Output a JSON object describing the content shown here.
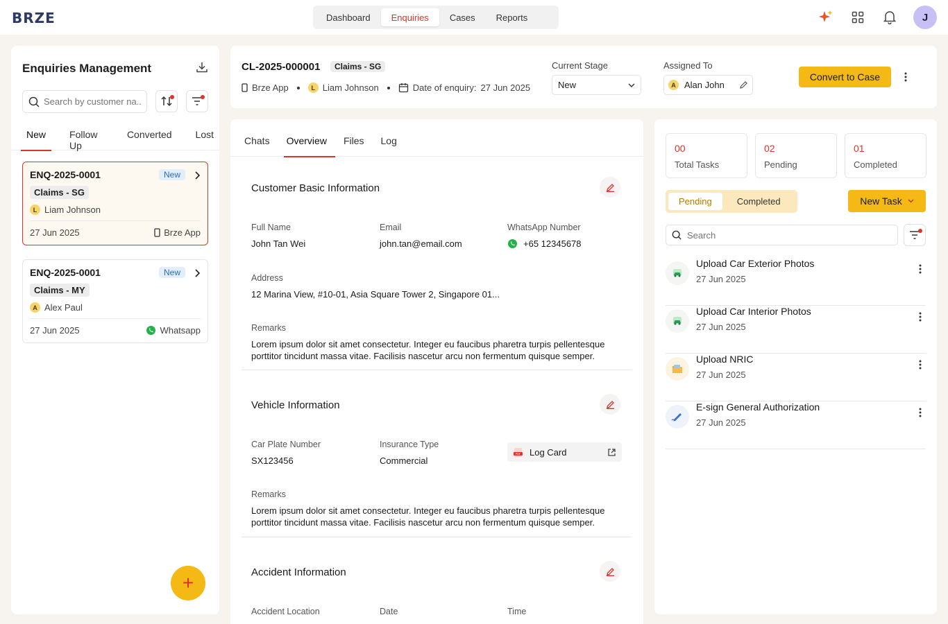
{
  "brand": {
    "logo": "BRZE"
  },
  "nav": {
    "items": [
      "Dashboard",
      "Enquiries",
      "Cases",
      "Reports"
    ],
    "active": "Enquiries"
  },
  "user": {
    "initial": "J"
  },
  "left": {
    "title": "Enquiries Management",
    "search_placeholder": "Search by customer na...",
    "tabs": [
      "New",
      "Follow Up",
      "Converted",
      "Lost"
    ],
    "cards": [
      {
        "id": "ENQ-2025-0001",
        "status": "New",
        "tag": "Claims - SG",
        "initial": "L",
        "person": "Liam Johnson",
        "date": "27 Jun 2025",
        "source": "Brze App"
      },
      {
        "id": "ENQ-2025-0001",
        "status": "New",
        "tag": "Claims - MY",
        "initial": "A",
        "person": "Alex Paul",
        "date": "27 Jun 2025",
        "source": "Whatsapp"
      }
    ],
    "fab": "+"
  },
  "header": {
    "case_id": "CL-2025-000001",
    "tag": "Claims - SG",
    "source": "Brze App",
    "owner_initial": "L",
    "owner": "Liam Johnson",
    "date_label": "Date of enquiry:",
    "date": "27 Jun 2025",
    "stage_label": "Current Stage",
    "stage_value": "New",
    "assigned_label": "Assigned To",
    "assigned_initial": "A",
    "assigned_value": "Alan John",
    "convert_label": "Convert to Case"
  },
  "mid": {
    "tabs": [
      "Chats",
      "Overview",
      "Files",
      "Log"
    ],
    "active_tab": "Overview",
    "customer": {
      "title": "Customer Basic Information",
      "full_name_label": "Full Name",
      "full_name": "John Tan Wei",
      "email_label": "Email",
      "email": "john.tan@email.com",
      "whatsapp_label": "WhatsApp Number",
      "whatsapp": "+65 12345678",
      "address_label": "Address",
      "address": "12 Marina View, #10-01, Asia Square Tower 2, Singapore 01...",
      "remarks_label": "Remarks",
      "remarks": "Lorem ipsum dolor sit amet consectetur. Integer eu faucibus pharetra turpis pellentesque porttitor tincidunt massa vitae. Facilisis nascetur arcu non fermentum quisque semper."
    },
    "vehicle": {
      "title": "Vehicle Information",
      "plate_label": "Car Plate Number",
      "plate": "SX123456",
      "insurance_label": "Insurance Type",
      "insurance": "Commercial",
      "log_card": "Log Card",
      "remarks_label": "Remarks",
      "remarks": "Lorem ipsum dolor sit amet consectetur. Integer eu faucibus pharetra turpis pellentesque porttitor tincidunt massa vitae. Facilisis nascetur arcu non fermentum quisque semper."
    },
    "accident": {
      "title": "Accident Information",
      "location_label": "Accident Location",
      "date_label": "Date",
      "time_label": "Time"
    }
  },
  "right": {
    "stats": [
      {
        "num": "00",
        "label": "Total Tasks"
      },
      {
        "num": "02",
        "label": "Pending"
      },
      {
        "num": "01",
        "label": "Completed"
      }
    ],
    "toggle": [
      "Pending",
      "Completed"
    ],
    "new_task": "New Task",
    "search_placeholder": "Search",
    "tasks": [
      {
        "title": "Upload Car Exterior Photos",
        "date": "27 Jun 2025",
        "icon": "car-photo-icon"
      },
      {
        "title": "Upload Car Interior Photos",
        "date": "27 Jun 2025",
        "icon": "car-photo-icon"
      },
      {
        "title": "Upload NRIC",
        "date": "27 Jun 2025",
        "icon": "id-folder-icon"
      },
      {
        "title": "E-sign General Authorization",
        "date": "27 Jun 2025",
        "icon": "pen-sign-icon"
      }
    ]
  },
  "colors": {
    "accent": "#d9342b",
    "primary_button": "#f5b915",
    "logo": "#2d3a66"
  }
}
